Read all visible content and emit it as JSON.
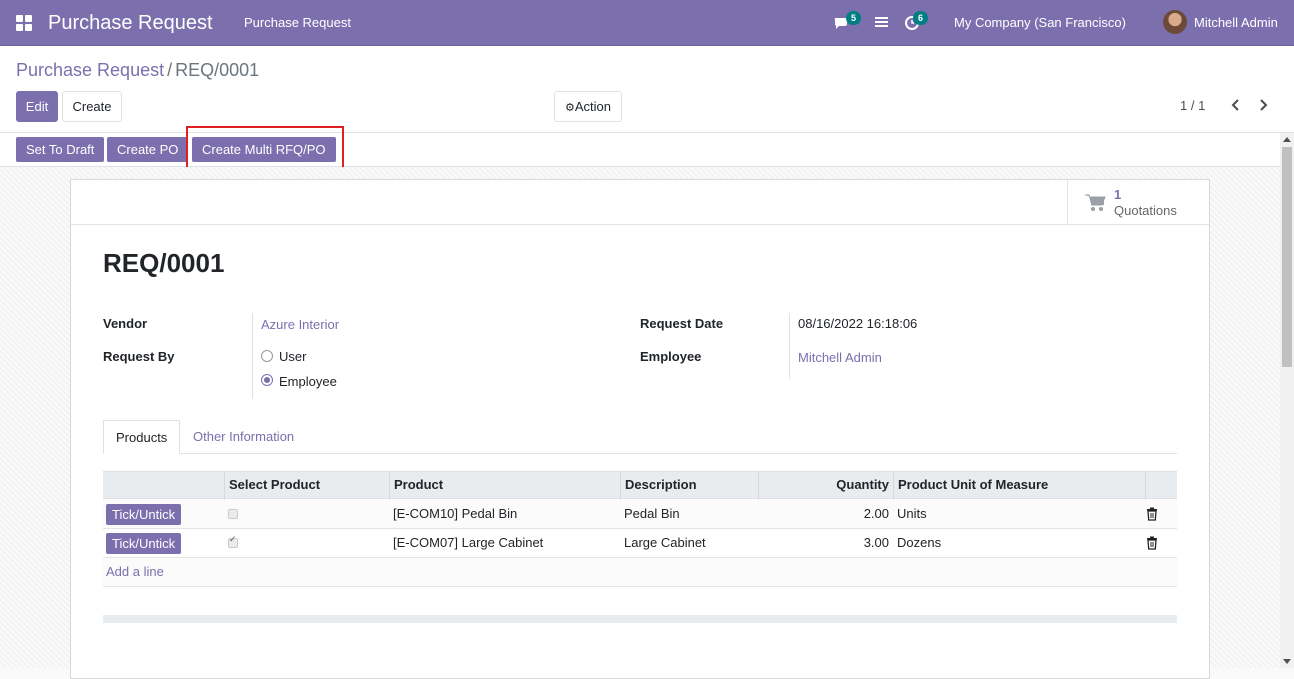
{
  "navbar": {
    "app_title": "Purchase Request",
    "menu_item": "Purchase Request",
    "chat_count": "5",
    "activity_count": "6",
    "company": "My Company (San Francisco)",
    "user": "Mitchell Admin"
  },
  "breadcrumb": {
    "parent": "Purchase Request",
    "separator": "/",
    "current": "REQ/0001"
  },
  "control_panel": {
    "edit_label": "Edit",
    "create_label": "Create",
    "action_label": "Action",
    "pager": "1 / 1"
  },
  "statusbar": {
    "set_to_draft": "Set To Draft",
    "create_po": "Create PO",
    "create_multi": "Create Multi RFQ/PO"
  },
  "smart_button": {
    "value": "1",
    "label": "Quotations"
  },
  "form": {
    "title": "REQ/0001",
    "vendor_label": "Vendor",
    "vendor_value": "Azure Interior",
    "request_by_label": "Request By",
    "request_by_options": [
      "User",
      "Employee"
    ],
    "request_by_selected": "Employee",
    "request_date_label": "Request Date",
    "request_date_value": "08/16/2022 16:18:06",
    "employee_label": "Employee",
    "employee_value": "Mitchell Admin"
  },
  "tabs": [
    "Products",
    "Other Information"
  ],
  "table": {
    "columns": [
      "Select Product",
      "Product",
      "Description",
      "Quantity",
      "Product Unit of Measure"
    ],
    "tick_label": "Tick/Untick",
    "rows": [
      {
        "selected": false,
        "product": "[E-COM10] Pedal Bin",
        "description": "Pedal Bin",
        "quantity": "2.00",
        "uom": "Units"
      },
      {
        "selected": true,
        "product": "[E-COM07] Large Cabinet",
        "description": "Large Cabinet",
        "quantity": "3.00",
        "uom": "Dozens"
      }
    ],
    "add_line": "Add a line"
  },
  "colors": {
    "brand": "#7c6fae",
    "badge": "#017e84",
    "highlight": "#e02020"
  }
}
